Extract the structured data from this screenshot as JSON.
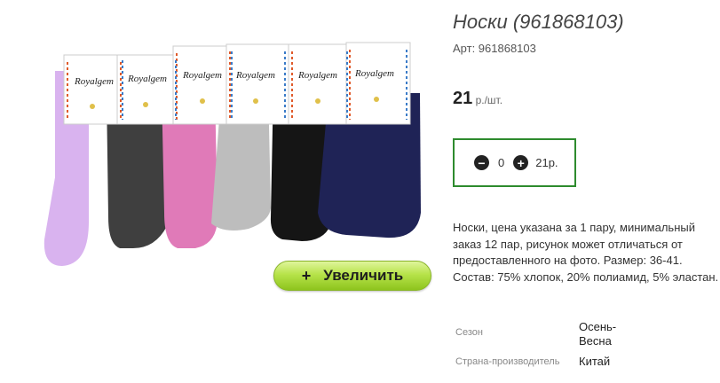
{
  "product": {
    "title": "Носки (961868103)",
    "sku": "Арт: 961868103",
    "price_value": "21",
    "price_unit": " р./шт.",
    "photo_alt": "Носки Royalgem",
    "brand_tag": "Royalgem",
    "zoom_button": "Увеличить",
    "zoom_icon": "+"
  },
  "cart": {
    "minus_icon": "minus-circle-icon",
    "plus_icon": "plus-circle-icon",
    "quantity": "0",
    "sum": "21р."
  },
  "description": "Носки, цена указана за 1 пару, минимальный заказ 12 пар, рисунок может отличаться от предоставленного на фото. Размер: 36-41. Состав: 75% хлопок, 20% полиамид, 5% эластан.",
  "attributes": [
    {
      "label": "Сезон",
      "value": "Осень-Весна"
    },
    {
      "label": "Страна-производитель",
      "value": "Китай"
    }
  ],
  "colors": {
    "button_green": "#b7e34a",
    "border_green": "#2e8b2e",
    "sock_lilac": "#d9b3ef",
    "sock_dark_grey": "#3f3f3f",
    "sock_pink": "#e07ab8",
    "sock_light_grey": "#bdbdbd",
    "sock_black": "#151515",
    "sock_navy": "#1f2356"
  }
}
